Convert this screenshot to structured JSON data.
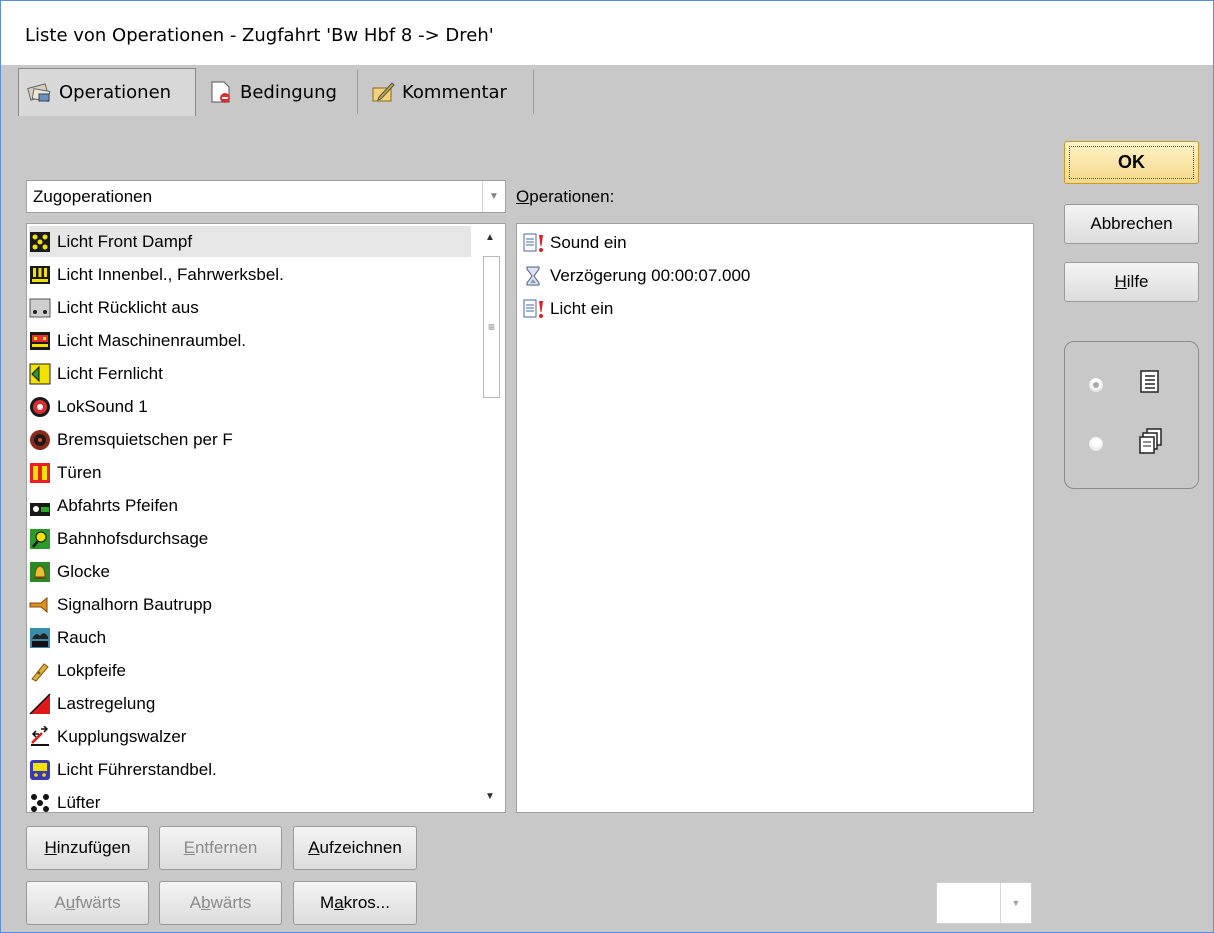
{
  "window": {
    "title": "Liste von Operationen - Zugfahrt 'Bw Hbf 8 -> Dreh'"
  },
  "tabs": [
    {
      "label": "Operationen",
      "icon": "operations-tab-icon",
      "active": true
    },
    {
      "label": "Bedingung",
      "icon": "condition-tab-icon",
      "active": false
    },
    {
      "label": "Kommentar",
      "icon": "comment-tab-icon",
      "active": false
    }
  ],
  "category": {
    "selected": "Zugoperationen"
  },
  "operations_label": "Operationen:",
  "available": {
    "items": [
      {
        "label": "Licht Front Dampf",
        "icon": "front-light-steam-icon",
        "selected": true
      },
      {
        "label": "Licht Innenbel., Fahrwerksbel.",
        "icon": "interior-light-icon"
      },
      {
        "label": "Licht Rücklicht aus",
        "icon": "rear-light-off-icon"
      },
      {
        "label": "Licht Maschinenraumbel.",
        "icon": "engine-room-light-icon"
      },
      {
        "label": "Licht Fernlicht",
        "icon": "high-beam-icon"
      },
      {
        "label": "LokSound 1",
        "icon": "loksound-icon"
      },
      {
        "label": "Bremsquietschen per F",
        "icon": "brake-squeal-icon"
      },
      {
        "label": "Türen",
        "icon": "doors-icon"
      },
      {
        "label": "Abfahrts Pfeifen",
        "icon": "departure-whistle-icon"
      },
      {
        "label": "Bahnhofsdurchsage",
        "icon": "station-announcement-icon"
      },
      {
        "label": "Glocke",
        "icon": "bell-icon"
      },
      {
        "label": "Signalhorn Bautrupp",
        "icon": "signal-horn-icon"
      },
      {
        "label": "Rauch",
        "icon": "smoke-icon"
      },
      {
        "label": "Lokpfeife",
        "icon": "loco-whistle-icon"
      },
      {
        "label": "Lastregelung",
        "icon": "load-control-icon"
      },
      {
        "label": "Kupplungswalzer",
        "icon": "coupling-waltz-icon"
      },
      {
        "label": "Licht Führerstandbel.",
        "icon": "cab-light-icon"
      },
      {
        "label": "Lüfter",
        "icon": "fan-icon"
      }
    ]
  },
  "operations": {
    "items": [
      {
        "label": "Sound ein",
        "icon": "function-on-icon"
      },
      {
        "label": "Verzögerung 00:00:07.000",
        "icon": "hourglass-icon"
      },
      {
        "label": "Licht ein",
        "icon": "function-on-icon"
      }
    ]
  },
  "buttons": {
    "add": {
      "pre": "",
      "u": "H",
      "post": "inzufügen",
      "enabled": true
    },
    "remove": {
      "pre": "",
      "u": "E",
      "post": "ntfernen",
      "enabled": false
    },
    "record": {
      "pre": "",
      "u": "A",
      "post": "ufzeichnen",
      "enabled": true
    },
    "up": {
      "pre": "A",
      "u": "u",
      "post": "fwärts",
      "enabled": false
    },
    "down": {
      "pre": "A",
      "u": "b",
      "post": "wärts",
      "enabled": false
    },
    "macros": {
      "pre": "M",
      "u": "a",
      "post": "kros...",
      "enabled": true
    },
    "ok": {
      "label": "OK"
    },
    "cancel": {
      "label": "Abbrechen"
    },
    "help": {
      "pre": "",
      "u": "H",
      "post": "ilfe"
    }
  },
  "view_mode": {
    "options": [
      {
        "icon": "list-view-icon",
        "checked": true
      },
      {
        "icon": "copy-view-icon",
        "checked": false
      }
    ]
  },
  "small_combo": {
    "value": ""
  },
  "colors": {
    "ok_button": "#f5d98a",
    "accent_border": "#5a8fd6",
    "window_bg": "#c8c8c8"
  }
}
